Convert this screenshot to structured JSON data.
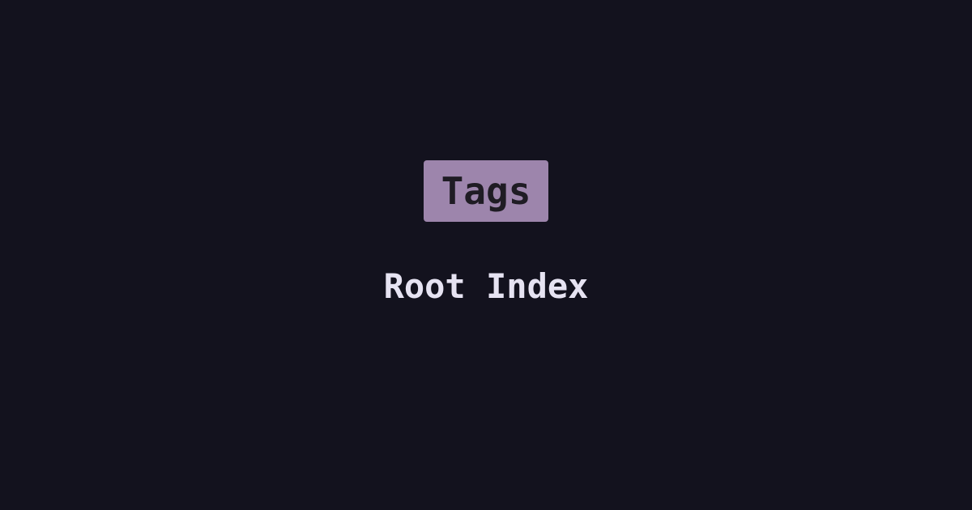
{
  "colors": {
    "background": "#13121e",
    "badge_background": "#9d85ac",
    "badge_text": "#1f1c24",
    "title_text": "#e6e3f2"
  },
  "badge": {
    "label": "Tags"
  },
  "title": {
    "text": "Root Index"
  }
}
